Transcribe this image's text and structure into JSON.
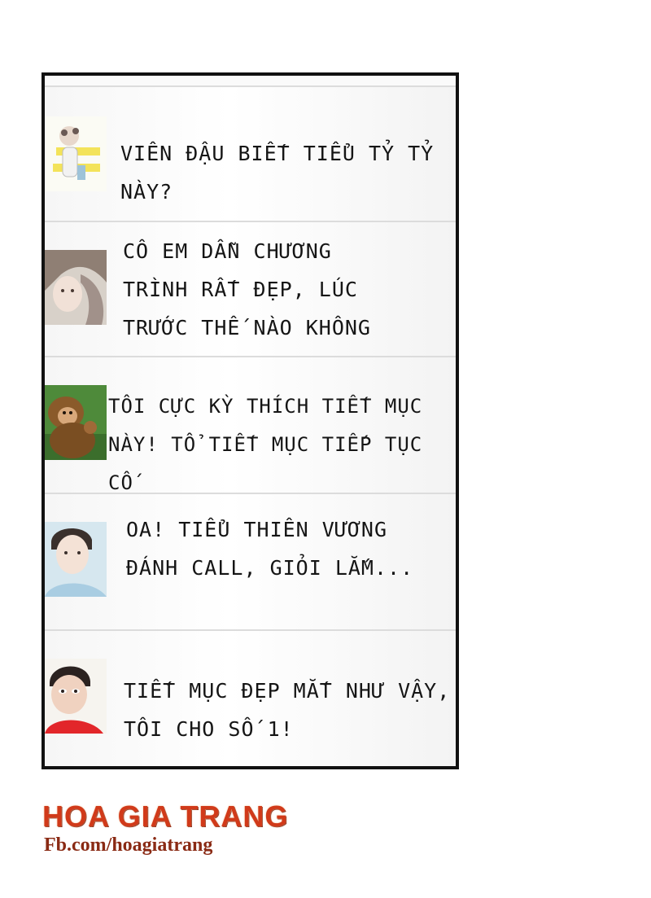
{
  "comments": [
    {
      "avatar": "chibi-character-avatar",
      "text": "VIÊN ĐẬU BIẾT TIỂU TỶ TỶ\nNÀY?"
    },
    {
      "avatar": "girl-long-hair-avatar",
      "text": "CÔ EM DẪN CHƯƠNG\nTRÌNH RẤT ĐẸP, LÚC\nTRƯỚC THẾ NÀO KHÔNG"
    },
    {
      "avatar": "monkey-avatar",
      "text": "TÔI CỰC KỲ THÍCH TIẾT MỤC\nNÀY! TỔ TIẾT MỤC TIẾP TỤC CỐ"
    },
    {
      "avatar": "young-man-avatar",
      "text": "OA! TIỂU THIÊN VƯƠNG\nĐÁNH CALL, GIỎI LẮM..."
    },
    {
      "avatar": "boy-red-shirt-avatar",
      "text": "TIẾT MỤC ĐẸP MẮT NHƯ VẬY,\nTÔI CHO SỐ 1!"
    }
  ],
  "watermark": {
    "title": "HOA GIA TRANG",
    "url": "Fb.com/hoagiatrang"
  },
  "colors": {
    "border": "#111111",
    "divider": "#dcdcdc",
    "watermark_red": "#d13a1a"
  }
}
